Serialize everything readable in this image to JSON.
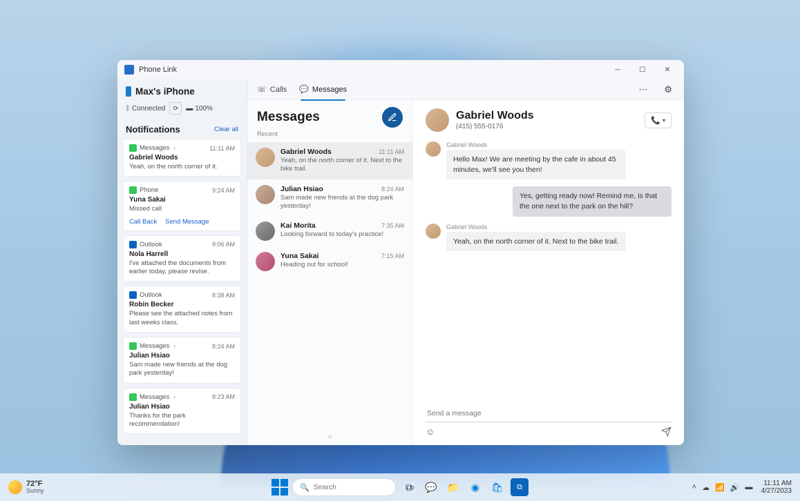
{
  "window": {
    "title": "Phone Link",
    "device_name": "Max's iPhone",
    "status_connected": "Connected",
    "status_battery": "100%"
  },
  "sidebar": {
    "notifications_title": "Notifications",
    "clear_all": "Clear all",
    "items": [
      {
        "app": "Messages",
        "icon": "msg",
        "time": "11:11 AM",
        "sender": "Gabriel Woods",
        "body": "Yeah, on the north corner of it.",
        "chev": true
      },
      {
        "app": "Phone",
        "icon": "phone",
        "time": "9:24 AM",
        "sender": "Yuna Sakai",
        "body": "Missed call",
        "actions": [
          "Call Back",
          "Send Message"
        ]
      },
      {
        "app": "Outlook",
        "icon": "outlook",
        "time": "9:06 AM",
        "sender": "Nola Harrell",
        "body": "I've attached the documents from earlier today, please revise."
      },
      {
        "app": "Outlook",
        "icon": "outlook",
        "time": "8:38 AM",
        "sender": "Robin Becker",
        "body": "Please see the attached notes from last weeks class."
      },
      {
        "app": "Messages",
        "icon": "msg",
        "time": "8:24 AM",
        "sender": "Julian Hsiao",
        "body": "Sam made new friends at the dog park yesterday!",
        "chev": true
      },
      {
        "app": "Messages",
        "icon": "msg",
        "time": "8:23 AM",
        "sender": "Julian Hsiao",
        "body": "Thanks for the park recommendation!",
        "chev": true
      }
    ]
  },
  "tabs": {
    "calls": "Calls",
    "messages": "Messages"
  },
  "messages_col": {
    "title": "Messages",
    "recent": "Recent",
    "threads": [
      {
        "name": "Gabriel Woods",
        "time": "11:11 AM",
        "snip": "Yeah, on the north corner of it. Next to the bike trail.",
        "avatar": "a1",
        "active": true
      },
      {
        "name": "Julian Hsiao",
        "time": "8:24 AM",
        "snip": "Sam made new friends at the dog park yesterday!",
        "avatar": "a2"
      },
      {
        "name": "Kai Morita",
        "time": "7:35 AM",
        "snip": "Looking forward to today's practice!",
        "avatar": "a3"
      },
      {
        "name": "Yuna Sakai",
        "time": "7:15 AM",
        "snip": "Heading out for school!",
        "avatar": "a4"
      }
    ]
  },
  "conversation": {
    "name": "Gabriel Woods",
    "phone": "(415) 555-0176",
    "messages": [
      {
        "dir": "in",
        "sender": "Gabriel Woods",
        "text": "Hello Max! We are meeting by the cafe in about 45 minutes, we'll see you then!"
      },
      {
        "dir": "out",
        "text": "Yes, getting ready now! Remind me, is that the one next to the park on the hill?"
      },
      {
        "dir": "in",
        "sender": "Gabriel Woods",
        "text": "Yeah, on the north corner of it. Next to the bike trail."
      }
    ],
    "compose_placeholder": "Send a message"
  },
  "taskbar": {
    "weather_temp": "72°F",
    "weather_cond": "Sunny",
    "search_placeholder": "Search",
    "time": "11:11 AM",
    "date": "4/27/2023"
  }
}
